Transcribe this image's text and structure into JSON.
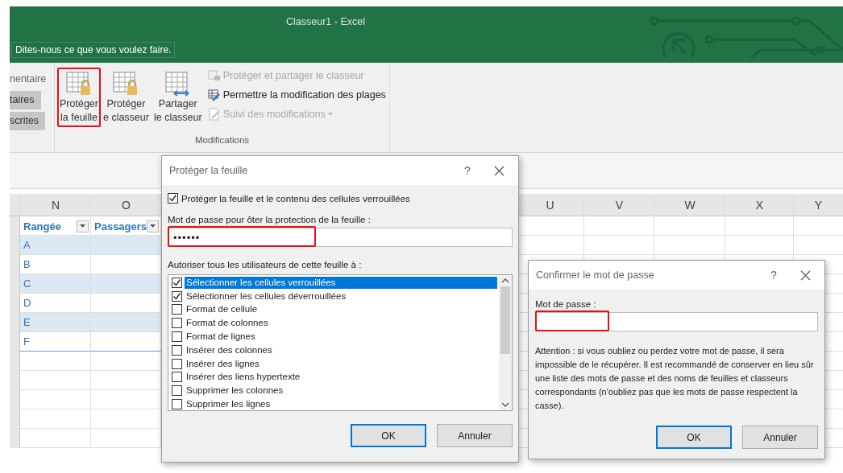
{
  "window": {
    "title": "Classeur1 - Excel"
  },
  "tell_me": {
    "placeholder": "Dites-nous ce que vous voulez faire."
  },
  "ribbon": {
    "partial_group": [
      {
        "label": "nentaire",
        "pressed": false
      },
      {
        "label": "taires",
        "pressed": true
      },
      {
        "label": "scrites",
        "pressed": true
      }
    ],
    "group": {
      "label": "Modifications",
      "large_buttons": [
        {
          "kind": "protect-sheet",
          "label": "Protéger\nla feuille",
          "highlighted": true
        },
        {
          "kind": "protect-workbook",
          "label": "Protéger\ne classeur",
          "highlighted": false
        },
        {
          "kind": "share-workbook",
          "label": "Partager\nle classeur",
          "highlighted": false
        }
      ],
      "small_buttons": [
        {
          "kind": "protect-share",
          "label": "Protéger et partager le classeur",
          "disabled": true,
          "dropdown": false
        },
        {
          "kind": "allow-ranges",
          "label": "Permettre la modification des plages",
          "disabled": false,
          "dropdown": false
        },
        {
          "kind": "track-changes",
          "label": "Suivi des modifications",
          "disabled": true,
          "dropdown": true
        }
      ]
    }
  },
  "sheet": {
    "columns_left": [
      "N",
      "O"
    ],
    "columns_right": [
      "U",
      "V",
      "W",
      "X",
      "Y"
    ],
    "table": {
      "headers": [
        "Rangée",
        "Passagers"
      ],
      "rows": [
        "A",
        "B",
        "C",
        "D",
        "E",
        "F"
      ]
    }
  },
  "protect_dialog": {
    "title": "Protéger la feuille",
    "help": "?",
    "protect_option": {
      "label": "Protéger la feuille et le contenu des cellules verrouillées",
      "checked": true
    },
    "password_label": "Mot de passe pour ôter la protection de la feuille :",
    "password": {
      "value": "••••••",
      "highlighted": true
    },
    "list_label": "Autoriser tous les utilisateurs de cette feuille à :",
    "options": [
      {
        "label": "Sélectionner les cellules verrouillées",
        "checked": true,
        "selected": true
      },
      {
        "label": "Sélectionner les cellules déverrouillées",
        "checked": true,
        "selected": false
      },
      {
        "label": "Format de cellule",
        "checked": false,
        "selected": false
      },
      {
        "label": "Format de colonnes",
        "checked": false,
        "selected": false
      },
      {
        "label": "Format de lignes",
        "checked": false,
        "selected": false
      },
      {
        "label": "Insérer des colonnes",
        "checked": false,
        "selected": false
      },
      {
        "label": "Insérer des lignes",
        "checked": false,
        "selected": false
      },
      {
        "label": "Insérer des liens hypertexte",
        "checked": false,
        "selected": false
      },
      {
        "label": "Supprimer les colonnes",
        "checked": false,
        "selected": false
      },
      {
        "label": "Supprimer les lignes",
        "checked": false,
        "selected": false
      }
    ],
    "buttons": [
      {
        "label": "OK",
        "default": true
      },
      {
        "label": "Annuler",
        "default": false
      }
    ]
  },
  "confirm_dialog": {
    "title": "Confirmer le mot de passe",
    "help": "?",
    "password_label": "Mot de passe :",
    "password": {
      "highlighted": true
    },
    "warning": "Attention : si vous oubliez ou perdez votre mot de passe, il sera impossible de le récupérer. Il est recommandé de conserver en lieu sûr une liste des mots de passe et des noms de feuilles et classeurs correspondants (n'oubliez pas que les mots de passe respectent la casse).",
    "buttons": [
      {
        "label": "OK",
        "default": true
      },
      {
        "label": "Annuler",
        "default": false
      }
    ]
  }
}
